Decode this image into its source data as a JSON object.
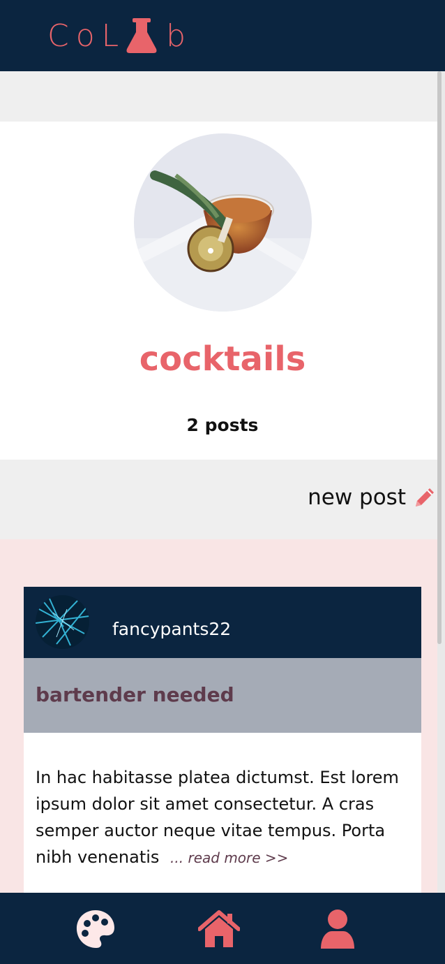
{
  "app": {
    "logo_text_left": "CoL",
    "logo_text_right": "b",
    "brand_color": "#e8646a",
    "nav_color": "#0b2540"
  },
  "group": {
    "image_icon": "cocktail-photo",
    "name": "cocktails",
    "post_count": "2 posts"
  },
  "actions": {
    "new_post_label": "new post",
    "new_post_icon": "pencil-icon"
  },
  "posts": [
    {
      "avatar_icon": "abstract-blue-lines-photo",
      "username": "fancypants22",
      "title": "bartender needed",
      "excerpt": "In hac habitasse platea dictumst. Est lorem ipsum dolor sit amet consectetur. A cras semper auctor neque vitae tempus. Porta nibh venenatis",
      "read_more": "... read more >>"
    }
  ],
  "bottom_nav": [
    {
      "icon": "palette-icon"
    },
    {
      "icon": "home-icon"
    },
    {
      "icon": "user-icon"
    }
  ]
}
